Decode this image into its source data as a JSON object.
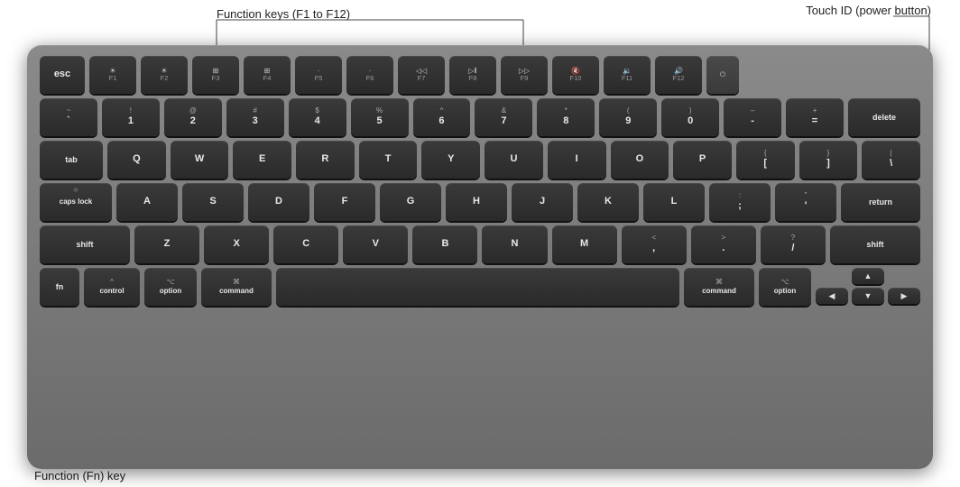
{
  "annotations": {
    "function_keys_label": "Function keys (F1 to F12)",
    "touch_id_label": "Touch ID (power button)",
    "fn_key_label": "Function (Fn) key"
  },
  "keyboard": {
    "rows": {
      "fn_row": [
        "esc",
        "F1",
        "F2",
        "F3",
        "F4",
        "F5",
        "F6",
        "F7",
        "F8",
        "F9",
        "F10",
        "F11",
        "F12",
        "touch_id"
      ],
      "number_row": [
        "~`",
        "!1",
        "@2",
        "#3",
        "$4",
        "%5",
        "^6",
        "&7",
        "*8",
        "(9",
        ")0",
        "-",
        "=+",
        "delete"
      ],
      "tab_row": [
        "tab",
        "Q",
        "W",
        "E",
        "R",
        "T",
        "Y",
        "U",
        "I",
        "O",
        "P",
        "{[",
        "}]",
        "|\\"
      ],
      "caps_row": [
        "caps lock",
        "A",
        "S",
        "D",
        "F",
        "G",
        "H",
        "J",
        "K",
        "L",
        ";:",
        "'\"",
        "return"
      ],
      "shift_row": [
        "shift",
        "Z",
        "X",
        "C",
        "V",
        "B",
        "N",
        "M",
        "<,",
        ">.",
        "?/",
        "shift"
      ],
      "bottom_row": [
        "fn",
        "control",
        "option",
        "command",
        "space",
        "command",
        "option",
        "arrows"
      ]
    }
  }
}
